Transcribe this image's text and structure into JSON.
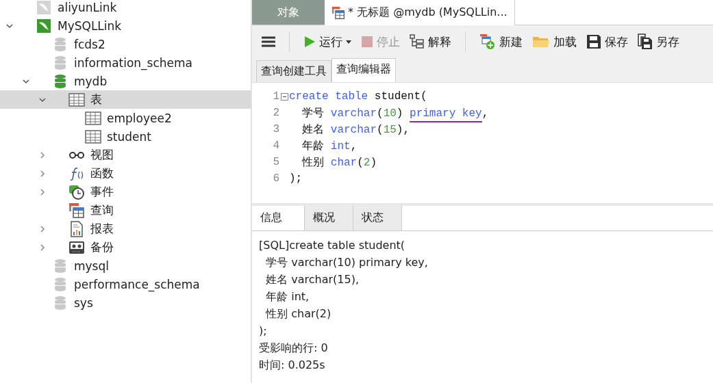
{
  "navigator": {
    "tree": [
      {
        "label": "aliyunLink",
        "kind": "connection",
        "open": false,
        "selected": false
      },
      {
        "label": "MySQLLink",
        "kind": "connection",
        "open": true,
        "expanded": true,
        "selected": false,
        "children": [
          {
            "label": "fcds2",
            "kind": "database",
            "open": false,
            "selected": false
          },
          {
            "label": "information_schema",
            "kind": "database",
            "open": false,
            "selected": false
          },
          {
            "label": "mydb",
            "kind": "database",
            "open": true,
            "expanded": true,
            "selected": false,
            "children": [
              {
                "label": "表",
                "kind": "tables",
                "expanded": true,
                "selected": true,
                "children": [
                  {
                    "label": "employee2",
                    "kind": "table",
                    "selected": false
                  },
                  {
                    "label": "student",
                    "kind": "table",
                    "selected": false
                  }
                ]
              },
              {
                "label": "视图",
                "kind": "views",
                "expanded": false,
                "selected": false
              },
              {
                "label": "函数",
                "kind": "functions",
                "expanded": false,
                "selected": false
              },
              {
                "label": "事件",
                "kind": "events",
                "expanded": false,
                "selected": false
              },
              {
                "label": "查询",
                "kind": "queries",
                "selected": false
              },
              {
                "label": "报表",
                "kind": "reports",
                "expanded": false,
                "selected": false
              },
              {
                "label": "备份",
                "kind": "backups",
                "expanded": false,
                "selected": false
              }
            ]
          },
          {
            "label": "mysql",
            "kind": "database",
            "open": false,
            "selected": false
          },
          {
            "label": "performance_schema",
            "kind": "database",
            "open": false,
            "selected": false
          },
          {
            "label": "sys",
            "kind": "database",
            "open": false,
            "selected": false
          }
        ]
      }
    ]
  },
  "doc_tabs": [
    {
      "label": "对象",
      "kind": "objects",
      "selected": false
    },
    {
      "label": "* 无标题 @mydb (MySQLLin...",
      "kind": "query",
      "selected": true
    }
  ],
  "toolbar": [
    {
      "kind": "menu"
    },
    {
      "label": "运行",
      "kind": "run",
      "dropdown": true,
      "disabled": false,
      "separator_before": true
    },
    {
      "label": "停止",
      "kind": "stop",
      "disabled": true
    },
    {
      "label": "解释",
      "kind": "explain",
      "disabled": false
    },
    {
      "label": "新建",
      "kind": "new",
      "disabled": false,
      "separator_before": true
    },
    {
      "label": "加载",
      "kind": "load",
      "disabled": false
    },
    {
      "label": "保存",
      "kind": "save",
      "disabled": false
    },
    {
      "label": "另存",
      "kind": "saveas",
      "disabled": false
    }
  ],
  "editor_tabs": [
    {
      "label": "查询创建工具",
      "selected": false
    },
    {
      "label": "查询编辑器",
      "selected": true
    }
  ],
  "code": [
    {
      "number": "1",
      "tokens": [
        {
          "text": "create",
          "kind": "kw"
        },
        {
          "text": " table",
          "kind": "kw"
        },
        {
          "text": " student("
        }
      ]
    },
    {
      "number": "2",
      "tokens": [
        {
          "text": "  学号 "
        },
        {
          "text": "varchar",
          "kind": "kw"
        },
        {
          "text": "("
        },
        {
          "text": "10",
          "kind": "num"
        },
        {
          "text": ") "
        },
        {
          "text": "primary key",
          "kind": "kw",
          "underlined": true
        },
        {
          "text": ","
        }
      ]
    },
    {
      "number": "3",
      "tokens": [
        {
          "text": "  姓名 "
        },
        {
          "text": "varchar",
          "kind": "kw"
        },
        {
          "text": "("
        },
        {
          "text": "15",
          "kind": "num"
        },
        {
          "text": "),"
        }
      ]
    },
    {
      "number": "4",
      "tokens": [
        {
          "text": "  年龄 "
        },
        {
          "text": "int",
          "kind": "kw"
        },
        {
          "text": ","
        }
      ]
    },
    {
      "number": "5",
      "tokens": [
        {
          "text": "  性别 "
        },
        {
          "text": "char",
          "kind": "kw"
        },
        {
          "text": "("
        },
        {
          "text": "2",
          "kind": "num"
        },
        {
          "text": ")"
        }
      ]
    },
    {
      "number": "6",
      "tokens": [
        {
          "text": ");"
        }
      ]
    }
  ],
  "result_tabs": [
    {
      "label": "信息",
      "selected": true
    },
    {
      "label": "概况",
      "selected": false
    },
    {
      "label": "状态",
      "selected": false
    }
  ],
  "message": [
    "[SQL]create table student(",
    "  学号 varchar(10) primary key,",
    "  姓名 varchar(15),",
    "  年龄 int,",
    "  性别 char(2)",
    ");",
    "受影响的行: 0",
    "时间: 0.025s"
  ]
}
